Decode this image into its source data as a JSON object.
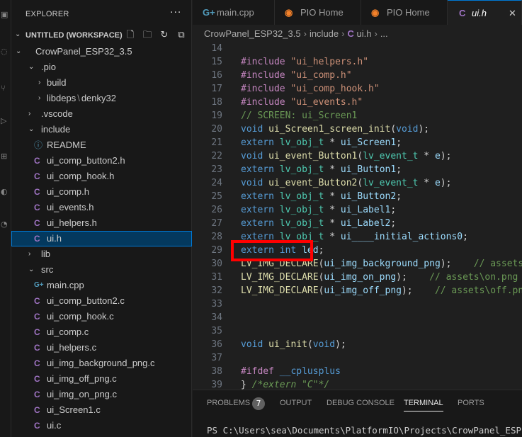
{
  "sidebar": {
    "title": "EXPLORER",
    "more": "···",
    "workspace": "UNTITLED (WORKSPACE)",
    "tree": [
      {
        "label": "CrowPanel_ESP32_3.5",
        "type": "folder",
        "open": true,
        "depth": 1
      },
      {
        "label": ".pio",
        "type": "folder",
        "open": true,
        "depth": 2
      },
      {
        "label": "build",
        "type": "folder",
        "open": false,
        "depth": 3
      },
      {
        "label": "libdeps",
        "suffix": "denky32",
        "type": "folder",
        "open": false,
        "depth": 3
      },
      {
        "label": ".vscode",
        "type": "folder",
        "open": false,
        "depth": 2
      },
      {
        "label": "include",
        "type": "folder",
        "open": true,
        "depth": 2
      },
      {
        "label": "README",
        "type": "info",
        "depth": 3
      },
      {
        "label": "ui_comp_button2.h",
        "type": "c",
        "depth": 3
      },
      {
        "label": "ui_comp_hook.h",
        "type": "c",
        "depth": 3
      },
      {
        "label": "ui_comp.h",
        "type": "c",
        "depth": 3
      },
      {
        "label": "ui_events.h",
        "type": "c",
        "depth": 3
      },
      {
        "label": "ui_helpers.h",
        "type": "c",
        "depth": 3
      },
      {
        "label": "ui.h",
        "type": "c",
        "depth": 3,
        "selected": true
      },
      {
        "label": "lib",
        "type": "folder",
        "open": false,
        "depth": 2
      },
      {
        "label": "src",
        "type": "folder",
        "open": true,
        "depth": 2
      },
      {
        "label": "main.cpp",
        "type": "cpp",
        "depth": 3
      },
      {
        "label": "ui_comp_button2.c",
        "type": "c",
        "depth": 3
      },
      {
        "label": "ui_comp_hook.c",
        "type": "c",
        "depth": 3
      },
      {
        "label": "ui_comp.c",
        "type": "c",
        "depth": 3
      },
      {
        "label": "ui_helpers.c",
        "type": "c",
        "depth": 3
      },
      {
        "label": "ui_img_background_png.c",
        "type": "c",
        "depth": 3
      },
      {
        "label": "ui_img_off_png.c",
        "type": "c",
        "depth": 3
      },
      {
        "label": "ui_img_on_png.c",
        "type": "c",
        "depth": 3
      },
      {
        "label": "ui_Screen1.c",
        "type": "c",
        "depth": 3
      },
      {
        "label": "ui.c",
        "type": "c",
        "depth": 3
      }
    ]
  },
  "tabs": [
    {
      "label": "main.cpp",
      "icon": "cpp-icon",
      "glyph": "G+",
      "active": false
    },
    {
      "label": "PIO Home",
      "icon": "platformio-icon",
      "glyph": "👽",
      "active": false
    },
    {
      "label": "PIO Home",
      "icon": "platformio-icon",
      "glyph": "👽",
      "active": false
    },
    {
      "label": "ui.h",
      "icon": "c-file-icon",
      "glyph": "C",
      "active": true
    }
  ],
  "breadcrumb": {
    "items": [
      "CrowPanel_ESP32_3.5",
      "include",
      "ui.h",
      "..."
    ],
    "file_glyph": "C"
  },
  "code": {
    "lines": [
      {
        "n": "14",
        "t": []
      },
      {
        "n": "15",
        "t": [
          [
            "pre",
            "#include "
          ],
          [
            "str",
            "\"ui_helpers.h\""
          ]
        ]
      },
      {
        "n": "16",
        "t": [
          [
            "pre",
            "#include "
          ],
          [
            "str",
            "\"ui_comp.h\""
          ]
        ]
      },
      {
        "n": "17",
        "t": [
          [
            "pre",
            "#include "
          ],
          [
            "str",
            "\"ui_comp_hook.h\""
          ]
        ]
      },
      {
        "n": "18",
        "t": [
          [
            "pre",
            "#include "
          ],
          [
            "str",
            "\"ui_events.h\""
          ]
        ]
      },
      {
        "n": "19",
        "t": [
          [
            "com",
            "// SCREEN: ui_Screen1"
          ]
        ]
      },
      {
        "n": "20",
        "t": [
          [
            "kw",
            "void "
          ],
          [
            "fn",
            "ui_Screen1_screen_init"
          ],
          [
            "txt",
            "("
          ],
          [
            "kw",
            "void"
          ],
          [
            "txt",
            ");"
          ]
        ]
      },
      {
        "n": "21",
        "t": [
          [
            "kw",
            "extern "
          ],
          [
            "type",
            "lv_obj_t"
          ],
          [
            "txt",
            " * "
          ],
          [
            "var",
            "ui_Screen1"
          ],
          [
            "txt",
            ";"
          ]
        ]
      },
      {
        "n": "22",
        "t": [
          [
            "kw",
            "void "
          ],
          [
            "fn",
            "ui_event_Button1"
          ],
          [
            "txt",
            "("
          ],
          [
            "type",
            "lv_event_t"
          ],
          [
            "txt",
            " * "
          ],
          [
            "var",
            "e"
          ],
          [
            "txt",
            ");"
          ]
        ]
      },
      {
        "n": "23",
        "t": [
          [
            "kw",
            "extern "
          ],
          [
            "type",
            "lv_obj_t"
          ],
          [
            "txt",
            " * "
          ],
          [
            "var",
            "ui_Button1"
          ],
          [
            "txt",
            ";"
          ]
        ]
      },
      {
        "n": "24",
        "t": [
          [
            "kw",
            "void "
          ],
          [
            "fn",
            "ui_event_Button2"
          ],
          [
            "txt",
            "("
          ],
          [
            "type",
            "lv_event_t"
          ],
          [
            "txt",
            " * "
          ],
          [
            "var",
            "e"
          ],
          [
            "txt",
            ");"
          ]
        ]
      },
      {
        "n": "25",
        "t": [
          [
            "kw",
            "extern "
          ],
          [
            "type",
            "lv_obj_t"
          ],
          [
            "txt",
            " * "
          ],
          [
            "var",
            "ui_Button2"
          ],
          [
            "txt",
            ";"
          ]
        ]
      },
      {
        "n": "26",
        "t": [
          [
            "kw",
            "extern "
          ],
          [
            "type",
            "lv_obj_t"
          ],
          [
            "txt",
            " * "
          ],
          [
            "var",
            "ui_Label1"
          ],
          [
            "txt",
            ";"
          ]
        ]
      },
      {
        "n": "27",
        "t": [
          [
            "kw",
            "extern "
          ],
          [
            "type",
            "lv_obj_t"
          ],
          [
            "txt",
            " * "
          ],
          [
            "var",
            "ui_Label2"
          ],
          [
            "txt",
            ";"
          ]
        ]
      },
      {
        "n": "28",
        "t": [
          [
            "kw",
            "extern "
          ],
          [
            "type",
            "lv_obj_t"
          ],
          [
            "txt",
            " * "
          ],
          [
            "var",
            "ui____initial_actions0"
          ],
          [
            "txt",
            ";"
          ]
        ]
      },
      {
        "n": "29",
        "t": [
          [
            "kw",
            "extern "
          ],
          [
            "kw",
            "int "
          ],
          [
            "var",
            "led"
          ],
          [
            "txt",
            ";"
          ]
        ]
      },
      {
        "n": "30",
        "t": [
          [
            "fn",
            "LV_IMG_DECLARE"
          ],
          [
            "txt",
            "("
          ],
          [
            "var",
            "ui_img_background_png"
          ],
          [
            "txt",
            ");    "
          ],
          [
            "com",
            "// assets\\"
          ]
        ]
      },
      {
        "n": "31",
        "t": [
          [
            "fn",
            "LV_IMG_DECLARE"
          ],
          [
            "txt",
            "("
          ],
          [
            "var",
            "ui_img_on_png"
          ],
          [
            "txt",
            ");    "
          ],
          [
            "com",
            "// assets\\on.png"
          ]
        ]
      },
      {
        "n": "32",
        "t": [
          [
            "fn",
            "LV_IMG_DECLARE"
          ],
          [
            "txt",
            "("
          ],
          [
            "var",
            "ui_img_off_png"
          ],
          [
            "txt",
            ");    "
          ],
          [
            "com",
            "// assets\\off.png"
          ]
        ]
      },
      {
        "n": "33",
        "t": []
      },
      {
        "n": "34",
        "t": []
      },
      {
        "n": "35",
        "t": []
      },
      {
        "n": "36",
        "t": [
          [
            "kw",
            "void "
          ],
          [
            "fn",
            "ui_init"
          ],
          [
            "txt",
            "("
          ],
          [
            "kw",
            "void"
          ],
          [
            "txt",
            ");"
          ]
        ]
      },
      {
        "n": "37",
        "t": []
      },
      {
        "n": "38",
        "t": [
          [
            "pre",
            "#ifdef "
          ],
          [
            "kw",
            "__cplusplus"
          ]
        ]
      },
      {
        "n": "39",
        "t": [
          [
            "txt",
            "} "
          ],
          [
            "comi",
            "/*extern \"C\"*/"
          ]
        ]
      }
    ]
  },
  "panel": {
    "tabs": [
      "PROBLEMS",
      "OUTPUT",
      "DEBUG CONSOLE",
      "TERMINAL",
      "PORTS"
    ],
    "active_tab": "TERMINAL",
    "problems_count": "7",
    "terminal_line": "PS C:\\Users\\sea\\Documents\\PlatformIO\\Projects\\CrowPanel_ESP"
  },
  "colors": {
    "accent": "#0078d4",
    "highlight_box": "#ff0000",
    "selection_bg": "#04395e"
  }
}
